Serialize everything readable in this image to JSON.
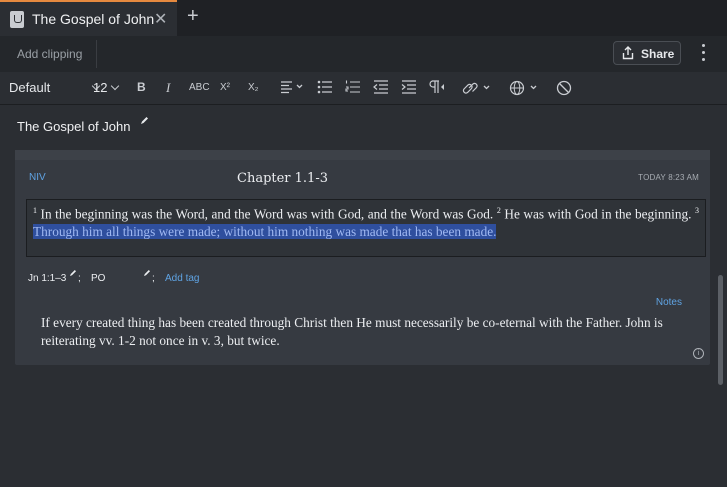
{
  "tab": {
    "title": "The Gospel of John",
    "close": "✕",
    "new_tab": "+"
  },
  "toolbar": {
    "add_clipping": "Add clipping",
    "share": "Share"
  },
  "format_bar": {
    "style": "Default",
    "size": "12",
    "bold": "B",
    "italic": "I",
    "smallcaps": "ABC",
    "superscript": "X²",
    "subscript": "X₂"
  },
  "document": {
    "title": "The Gospel of John"
  },
  "clipping": {
    "version": "NIV",
    "chapter": "Chapter 1.1-3",
    "timestamp": "TODAY 8:23 AM",
    "v1_num": "1",
    "v1_text": "In the beginning was the Word, and the Word was with God, and the Word was God.",
    "v2_num": "2",
    "v2_text": "He was with God in the beginning.",
    "v3_num": "3",
    "v3_text": "Through him all things were made; without him nothing was made that has been made.",
    "reference": "Jn 1:1–3",
    "ref_sep": ";",
    "tag": "PO",
    "tag_sep": ";",
    "add_tag": "Add tag",
    "notes_label": "Notes",
    "note": "If every created thing has been created through Christ then He must necessarily be co-eternal with the Father.  John is reiterating vv. 1-2 not once in v. 3, but twice.",
    "info": "i"
  },
  "colors": {
    "accent": "#e5893f",
    "link": "#5fa3e3",
    "highlight": "#2f4f9e"
  }
}
